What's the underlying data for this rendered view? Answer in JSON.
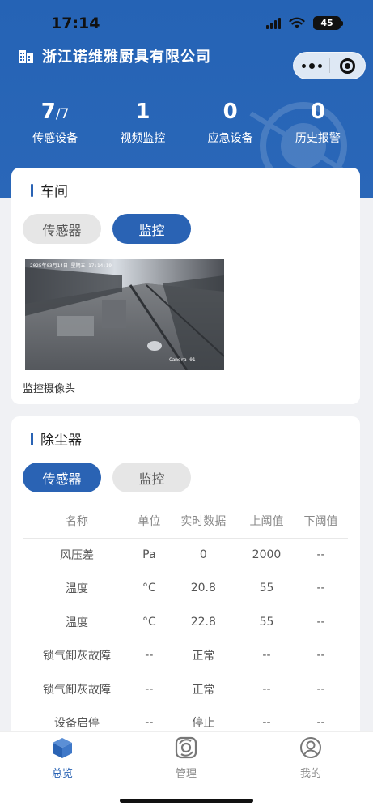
{
  "status_bar": {
    "time": "17:14",
    "battery": "45"
  },
  "header": {
    "company": "浙江诺维雅厨具有限公司"
  },
  "stats": [
    {
      "value": "7",
      "sub": "/7",
      "label": "传感设备"
    },
    {
      "value": "1",
      "sub": "",
      "label": "视频监控"
    },
    {
      "value": "0",
      "sub": "",
      "label": "应急设备"
    },
    {
      "value": "0",
      "sub": "",
      "label": "历史报警"
    }
  ],
  "workshop": {
    "title": "车间",
    "tabs": [
      "传感器",
      "监控"
    ],
    "active_tab": "监控",
    "camera": {
      "overlay_time": "2025年03月14日 星期五 17:14:19",
      "overlay_name": "Camera 01",
      "label": "监控摄像头"
    }
  },
  "dust": {
    "title": "除尘器",
    "tabs": [
      "传感器",
      "监控"
    ],
    "active_tab": "传感器",
    "columns": [
      "名称",
      "单位",
      "实时数据",
      "上阈值",
      "下阈值"
    ],
    "rows": [
      [
        "风压差",
        "Pa",
        "0",
        "2000",
        "--"
      ],
      [
        "温度",
        "°C",
        "20.8",
        "55",
        "--"
      ],
      [
        "温度",
        "°C",
        "22.8",
        "55",
        "--"
      ],
      [
        "锁气卸灰故障",
        "--",
        "正常",
        "--",
        "--"
      ],
      [
        "锁气卸灰故障",
        "--",
        "正常",
        "--",
        "--"
      ],
      [
        "设备启停",
        "--",
        "停止",
        "--",
        "--"
      ]
    ]
  },
  "nav": [
    {
      "label": "总览",
      "icon": "cube-icon",
      "active": true
    },
    {
      "label": "管理",
      "icon": "management-icon",
      "active": false
    },
    {
      "label": "我的",
      "icon": "user-icon",
      "active": false
    }
  ],
  "colors": {
    "primary": "#2a63b4",
    "header_bg": "#2563b5"
  }
}
